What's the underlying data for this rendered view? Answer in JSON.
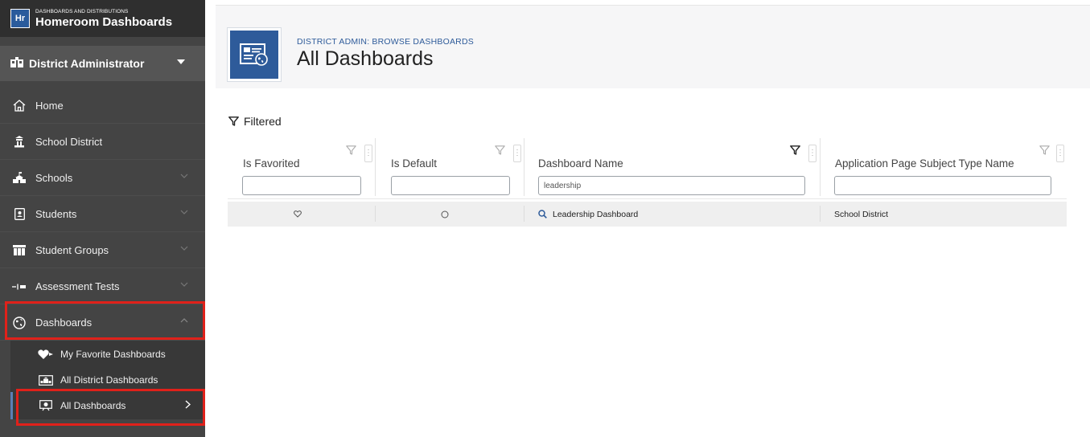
{
  "brand": {
    "logo": "Hr",
    "subtitle": "DASHBOARDS AND DISTRIBUTIONS",
    "title": "Homeroom Dashboards"
  },
  "role": {
    "label": "District Administrator"
  },
  "nav": {
    "home": "Home",
    "school_district": "School District",
    "schools": "Schools",
    "students": "Students",
    "student_groups": "Student Groups",
    "assessment_tests": "Assessment Tests",
    "dashboards": "Dashboards",
    "sub": {
      "my_favorite": "My Favorite Dashboards",
      "all_district": "All District Dashboards",
      "all_dashboards": "All Dashboards"
    }
  },
  "header": {
    "crumb": "DISTRICT ADMIN: BROWSE DASHBOARDS",
    "title": "All Dashboards"
  },
  "filter_label": "Filtered",
  "grid": {
    "columns": [
      "Is Favorited",
      "Is Default",
      "Dashboard Name",
      "Application Page Subject Type Name"
    ],
    "filters": [
      "",
      "",
      "leadership",
      ""
    ],
    "rows": [
      {
        "dashboard_name": "Leadership Dashboard",
        "subject_type": "School District"
      }
    ]
  },
  "colors": {
    "sidebar": "#444444",
    "brand_bg": "#2f2f2f",
    "accent": "#2e5b9a",
    "highlight": "#e0211a"
  }
}
